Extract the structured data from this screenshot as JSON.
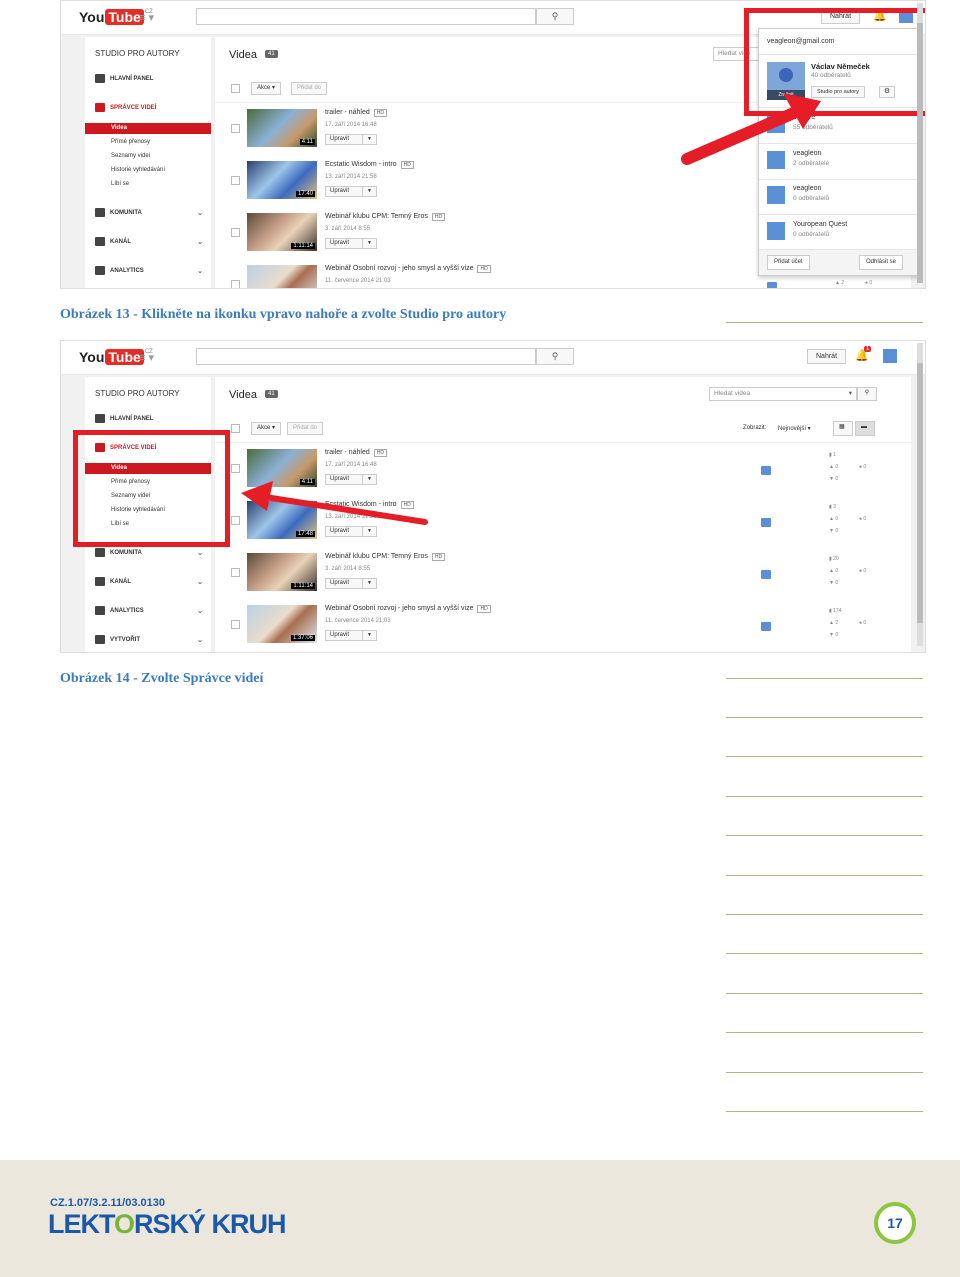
{
  "screenshot1": {
    "logo": {
      "you": "You",
      "tube": "Tube",
      "country": "CZ"
    },
    "upload_label": "Nahrát",
    "sidebar": {
      "title": "STUDIO PRO AUTORY",
      "dashboard": "HLAVNÍ PANEL",
      "video_manager": "SPRÁVCE VIDEÍ",
      "subitems": [
        "Videa",
        "Přímé přenosy",
        "Seznamy videí",
        "Historie vyhledávání",
        "Líbí se"
      ],
      "community": "KOMUNITA",
      "channel": "KANÁL",
      "analytics": "ANALYTICS"
    },
    "main": {
      "title": "Videa",
      "count": "41",
      "actions": "Akce",
      "add_to": "Přidat do",
      "search_placeholder": "Hledat vide"
    },
    "videos": [
      {
        "title": "trailer - náhled",
        "hd": "HD",
        "date": "17. září 2014 16:48",
        "duration": "4:11",
        "edit": "Upravit"
      },
      {
        "title": "Ecstatic Wisdom - intro",
        "hd": "HD",
        "date": "13. září 2014 21:58",
        "duration": "17:40",
        "edit": "Upravit"
      },
      {
        "title": "Webinář klubu CPM: Temný Eros",
        "hd": "HD",
        "date": "3. září 2014 8:55",
        "duration": "1:11:14",
        "edit": "Upravit"
      },
      {
        "title": "Webinář Osobní rozvoj - jeho smysl a vyšší vize",
        "hd": "HD",
        "date": "11. července 2014 21:03",
        "duration": "",
        "edit": "Upravit"
      }
    ],
    "account_menu": {
      "email": "veagleon@gmail.com",
      "name": "Václav Němeček",
      "subscribers": "40 odběratelů",
      "change_label": "Změnit",
      "studio_button": "Studio pro autory",
      "other_accounts": [
        {
          "name": "estlove",
          "subs": "55 odběratelů"
        },
        {
          "name": "veagleon",
          "subs": "2 odběratelé"
        },
        {
          "name": "veagleon",
          "subs": "0 odběratelů"
        },
        {
          "name": "Youropean Quest",
          "subs": "0 odběratelů"
        }
      ],
      "add_account": "Přidat účet",
      "sign_out": "Odhlásit se"
    },
    "stats_row4": {
      "likes": "2",
      "comments": "0"
    }
  },
  "caption1": "Obrázek 13 - Klikněte na ikonku vpravo nahoře a zvolte Studio pro autory",
  "screenshot2": {
    "logo": {
      "you": "You",
      "tube": "Tube",
      "country": "CZ"
    },
    "upload_label": "Nahrát",
    "notifications": "1",
    "sidebar": {
      "title": "STUDIO PRO AUTORY",
      "dashboard": "HLAVNÍ PANEL",
      "video_manager": "SPRÁVCE VIDEÍ",
      "subitems": [
        "Videa",
        "Přímé přenosy",
        "Seznamy videí",
        "Historie vyhledávání",
        "Líbí se"
      ],
      "community": "KOMUNITA",
      "channel": "KANÁL",
      "analytics": "ANALYTICS",
      "create": "VYTVOŘIT"
    },
    "main": {
      "title": "Videa",
      "count": "41",
      "actions": "Akce",
      "add_to": "Přidat do",
      "search_placeholder": "Hledat videa",
      "show_label": "Zobrazit:",
      "sort": "Nejnovější"
    },
    "videos": [
      {
        "title": "trailer - náhled",
        "hd": "HD",
        "date": "17. září 2014 16:48",
        "duration": "4:11",
        "edit": "Upravit",
        "views": "1",
        "likes": "0",
        "dislikes": "0",
        "comments": "0"
      },
      {
        "title": "Ecstatic Wisdom - intro",
        "hd": "HD",
        "date": "13. září 2014 21:58",
        "duration": "17:48",
        "edit": "Upravit",
        "views": "3",
        "likes": "0",
        "dislikes": "0",
        "comments": "0"
      },
      {
        "title": "Webinář klubu CPM: Temný Eros",
        "hd": "HD",
        "date": "3. září 2014 8:55",
        "duration": "1:11:14",
        "edit": "Upravit",
        "views": "20",
        "likes": "0",
        "dislikes": "0",
        "comments": "0"
      },
      {
        "title": "Webinář Osobní rozvoj - jeho smysl a vyšší vize",
        "hd": "HD",
        "date": "11. července 2014 21:03",
        "duration": "1:37:06",
        "edit": "Upravit",
        "views": "174",
        "likes": "2",
        "dislikes": "0",
        "comments": "0"
      }
    ]
  },
  "caption2": "Obrázek 14 - Zvolte Správce videí",
  "footer": {
    "project_code": "CZ.1.07/3.2.11/03.0130",
    "brand_a": "LEKT",
    "brand_o": "O",
    "brand_b": "RSKÝ KRUH",
    "page_number": "17"
  },
  "colors": {
    "caption": "#3a7cc0",
    "highlight": "#e41d26",
    "youtube_red": "#cc181e",
    "footer_bg": "#ebe7dd",
    "brand_blue": "#1b58a8",
    "brand_green": "#8cc63f"
  }
}
